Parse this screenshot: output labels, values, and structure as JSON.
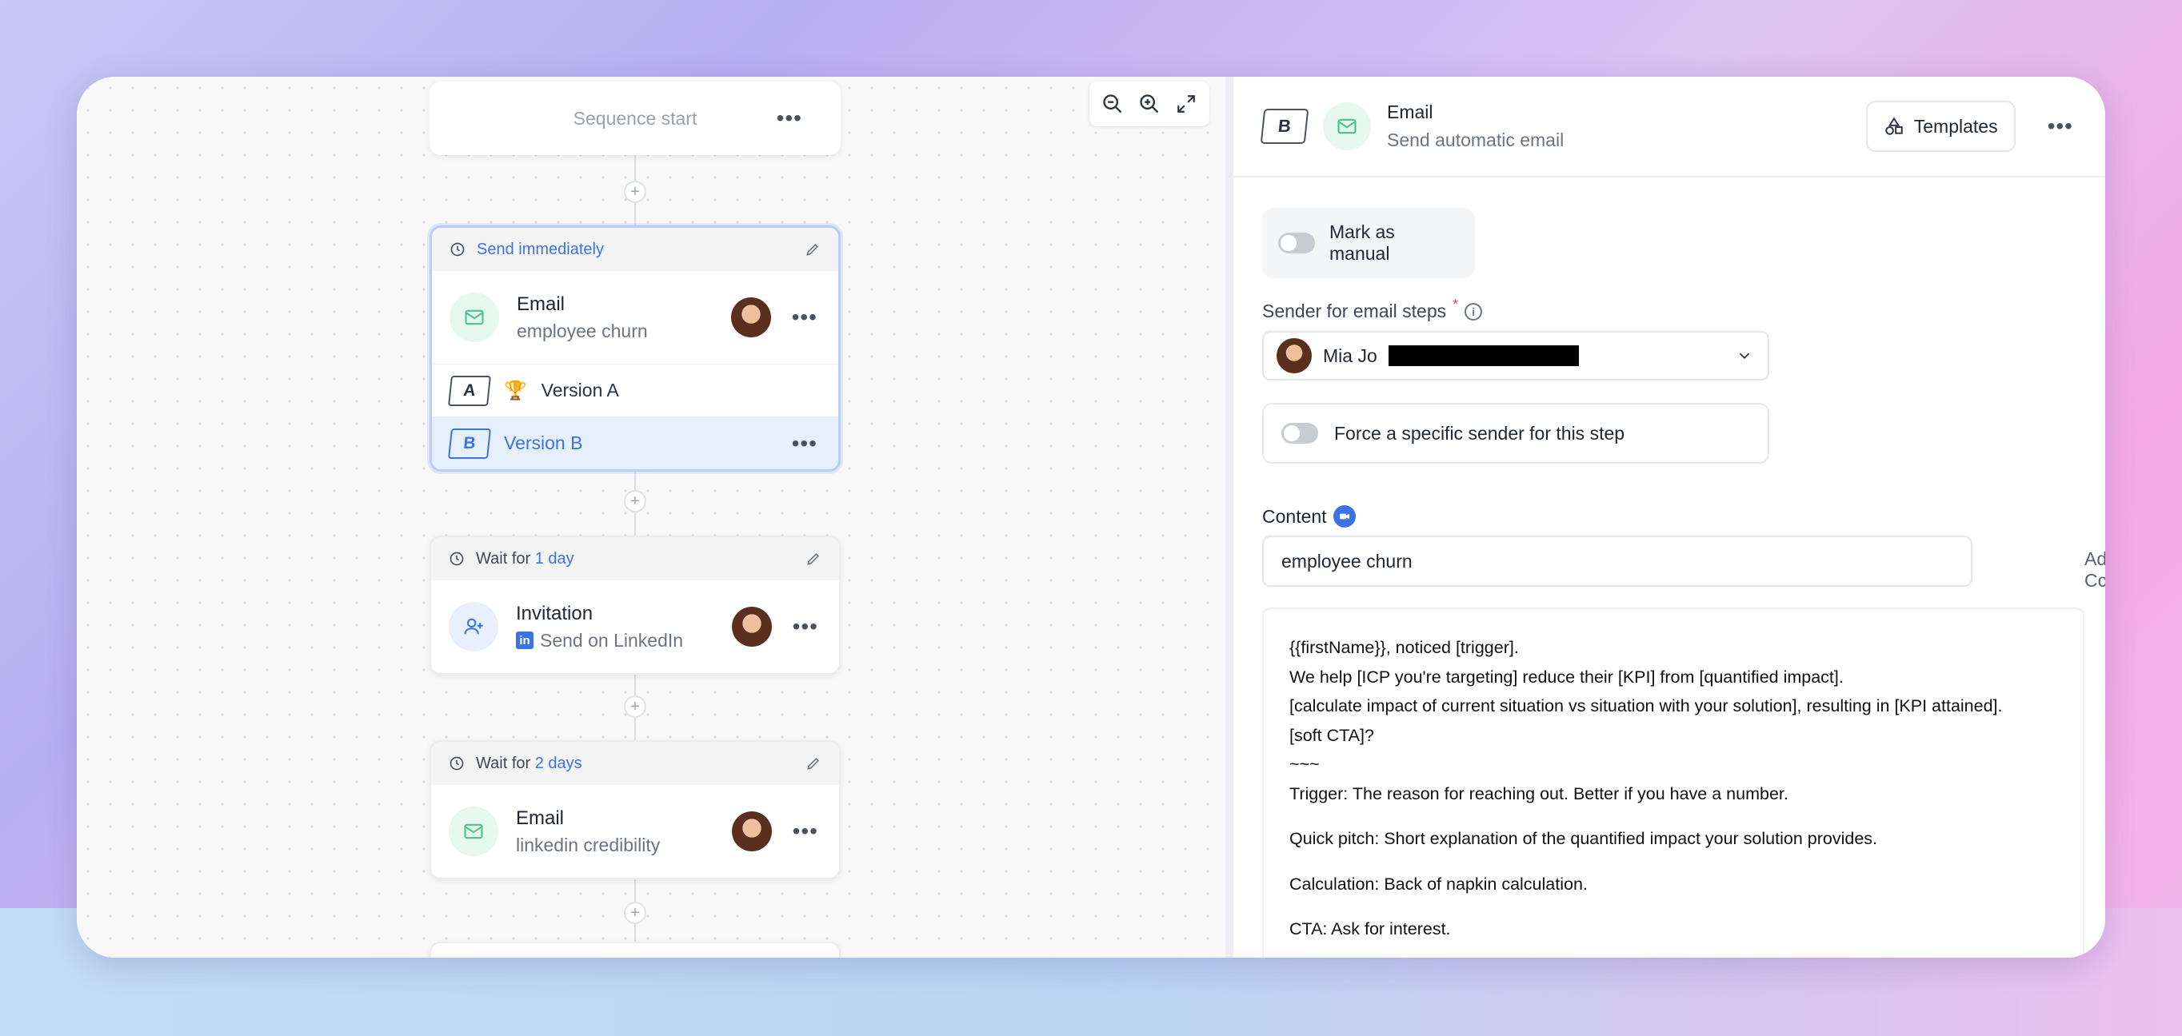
{
  "canvas": {
    "sequence_start": "Sequence start",
    "more": "•••",
    "plus": "+",
    "steps": [
      {
        "header_prefix": "Send immediately",
        "header_highlight": "",
        "title": "Email",
        "subtitle": "employee churn",
        "versions": [
          {
            "badge": "A",
            "trophy": "🏆",
            "label": "Version A"
          },
          {
            "badge": "B",
            "label": "Version B"
          }
        ]
      },
      {
        "header_prefix": "Wait for ",
        "header_highlight": "1 day",
        "title": "Invitation",
        "subtitle": "Send on LinkedIn",
        "linkedin_icon": "in"
      },
      {
        "header_prefix": "Wait for ",
        "header_highlight": "2 days",
        "title": "Email",
        "subtitle": "linkedin credibility"
      }
    ]
  },
  "panel": {
    "badge": "B",
    "title": "Email",
    "subtitle": "Send automatic email",
    "templates_label": "Templates",
    "more": "•••",
    "mark_manual_label": "Mark as manual",
    "sender_label": "Sender for email steps",
    "required_mark": "*",
    "info": "i",
    "sender_name": "Mia Jo",
    "force_sender_label": "Force a specific sender for this step",
    "content_label": "Content",
    "subject_value": "employee churn",
    "add_cc": "Add Cc",
    "body_lines": [
      "{{firstName}}, noticed [trigger].",
      "We help [ICP you're targeting] reduce their [KPI] from [quantified impact].",
      "[calculate impact of current situation vs situation with your solution], resulting in [KPI attained].",
      "[soft CTA]?",
      "~~~",
      "Trigger: The reason for reaching out. Better if you have a number.",
      "Quick pitch: Short explanation of the quantified impact your solution provides.",
      "Calculation: Back of napkin calculation.",
      "CTA: Ask for interest."
    ]
  },
  "colors": {
    "accent": "#3b73e6",
    "mail_bg": "#e5f7ef",
    "mail_icon": "#4cc38a",
    "user_bg": "#e8efff",
    "selected_border": "#b9cdf5"
  }
}
